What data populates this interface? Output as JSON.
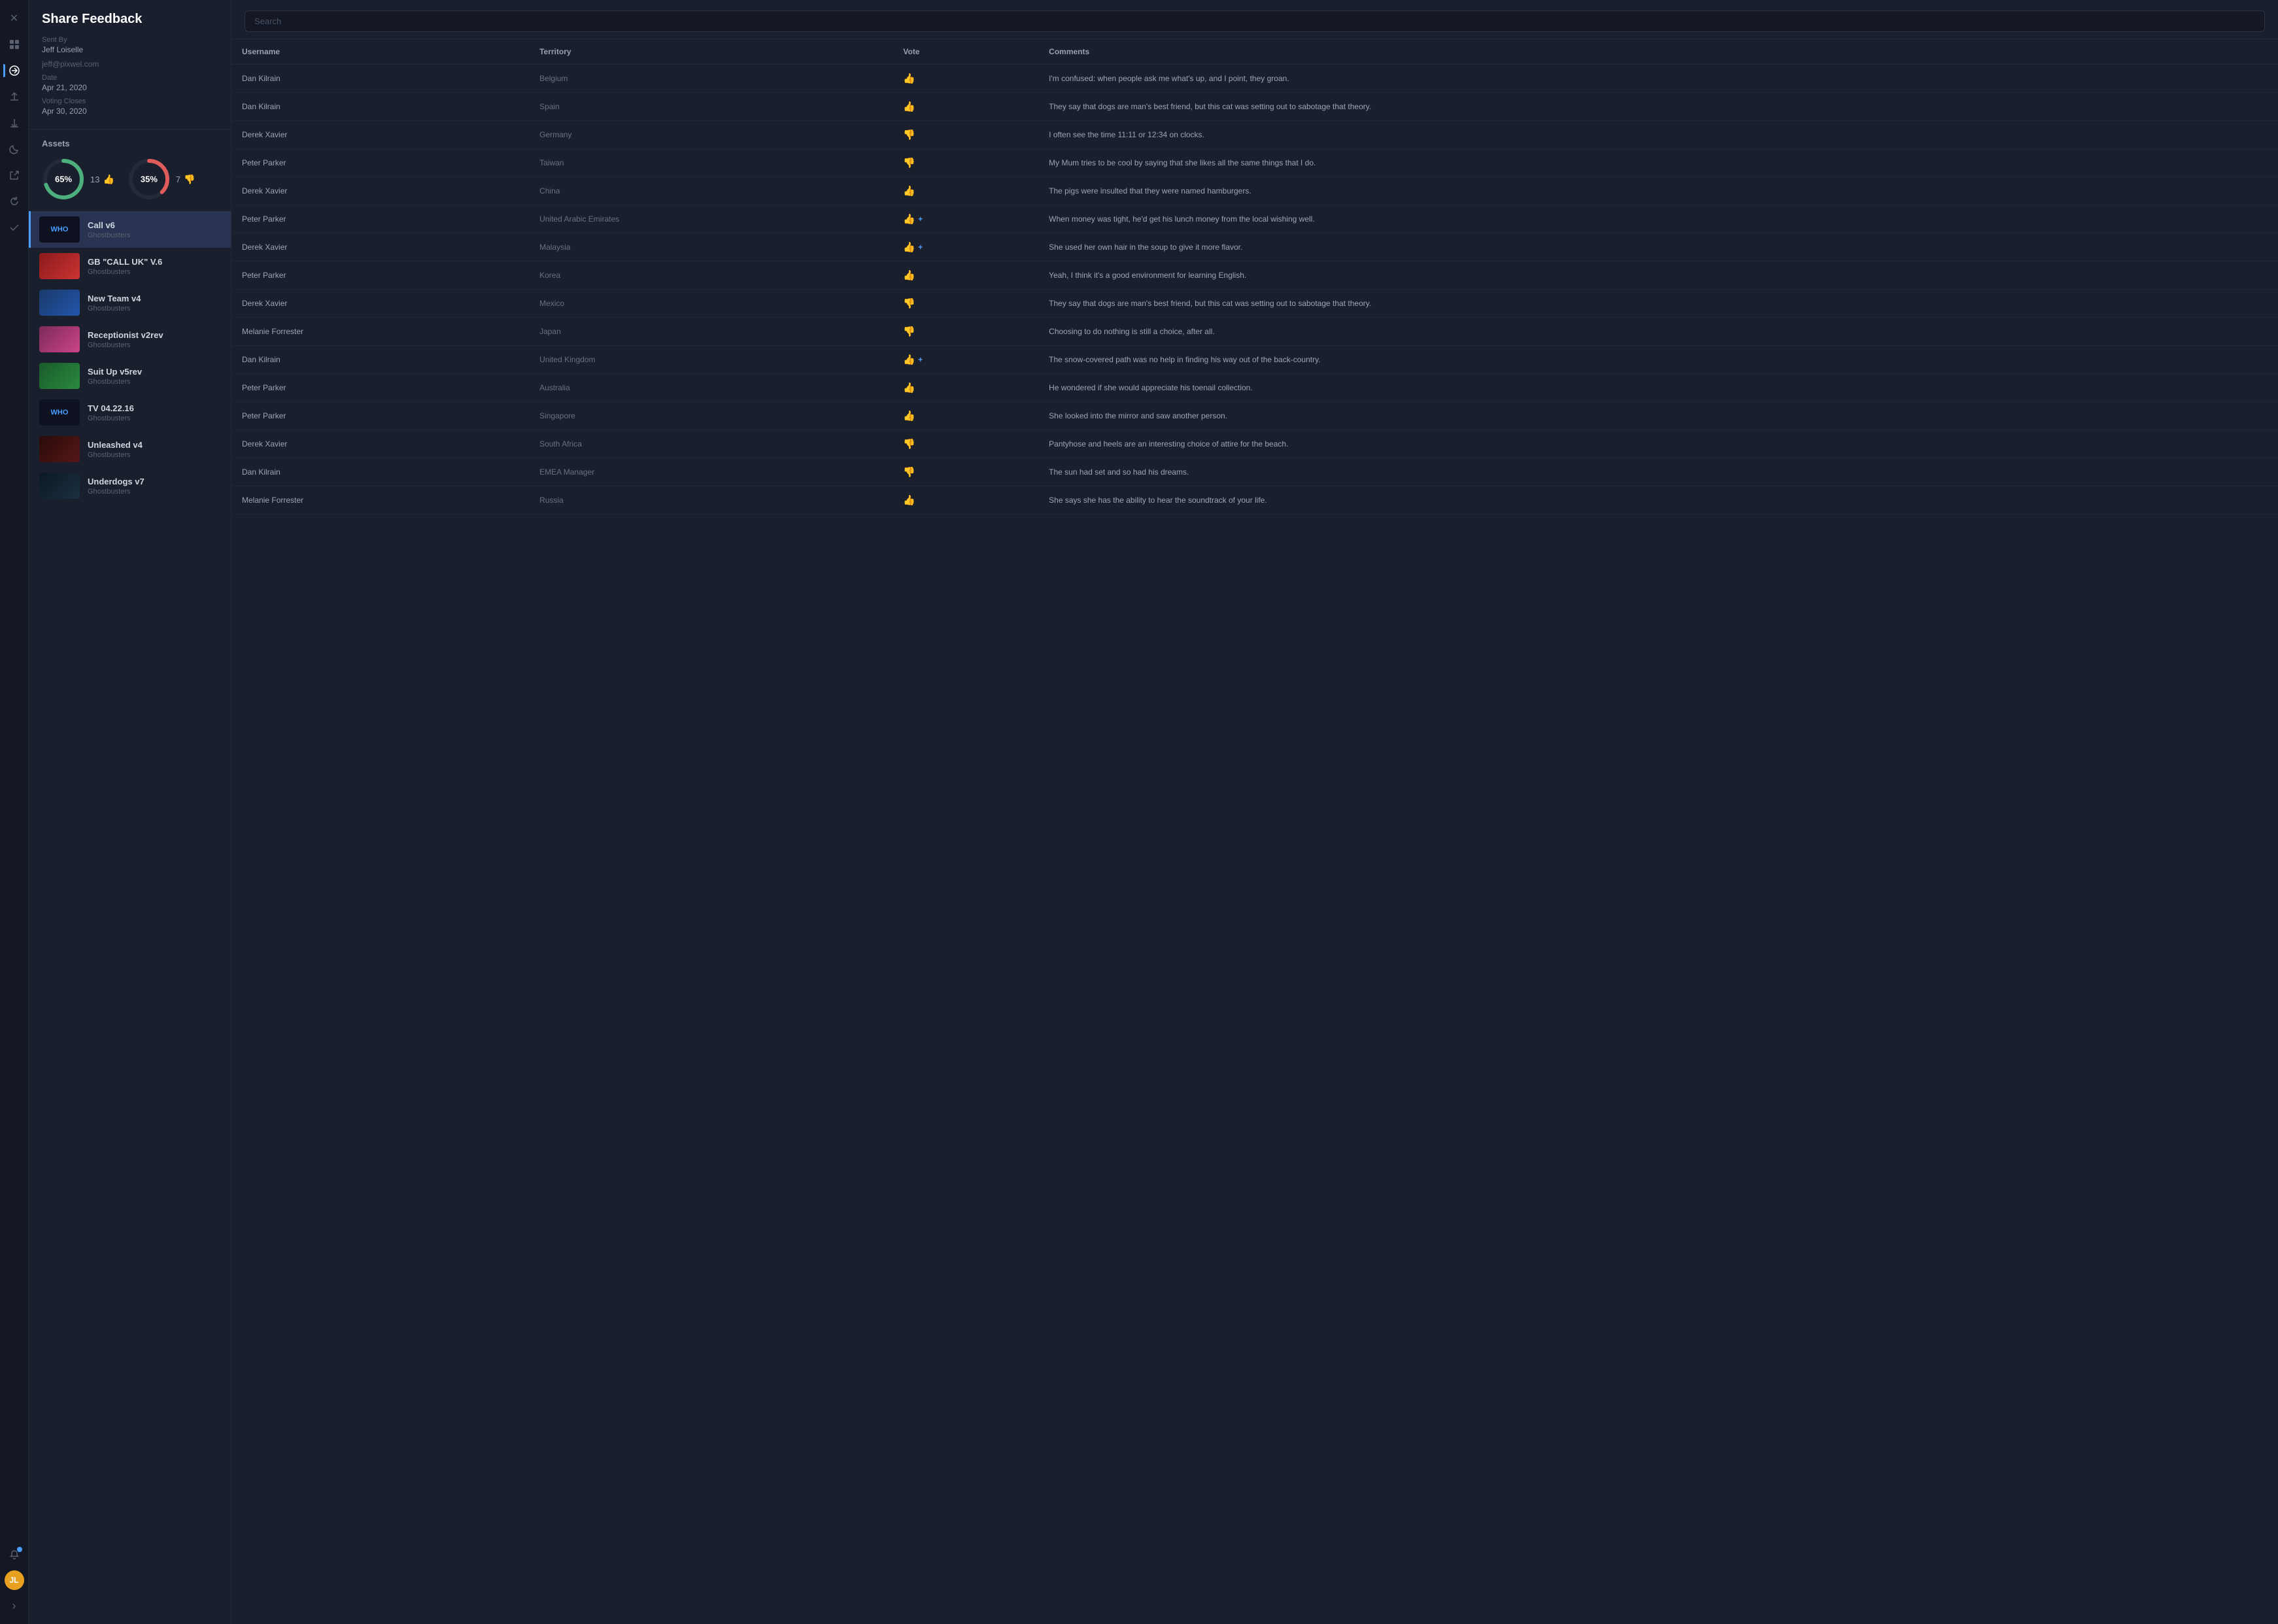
{
  "page": {
    "title": "Share Feedback"
  },
  "sidebar": {
    "sent_by_label": "Sent By",
    "sent_by_name": "Jeff Loiselle",
    "sent_by_email": "jeff@pixwel.com",
    "date_label": "Date",
    "date_value": "Apr 21, 2020",
    "voting_closes_label": "Voting Closes",
    "voting_closes_value": "Apr 30, 2020",
    "assets_label": "Assets"
  },
  "charts": {
    "upvote_percent": "65%",
    "upvote_count": "13",
    "downvote_percent": "35%",
    "downvote_count": "7",
    "upvote_circle_dash": "123",
    "upvote_circle_gap": "66",
    "downvote_circle_dash": "66",
    "downvote_circle_gap": "123"
  },
  "assets": [
    {
      "id": "a1",
      "name": "Call v6",
      "sub": "Ghostbusters",
      "thumb_class": "thumb-who",
      "thumb_text": "WHO",
      "selected": true
    },
    {
      "id": "a2",
      "name": "GB \"CALL UK\" V.6",
      "sub": "Ghostbusters",
      "thumb_class": "thumb-red",
      "thumb_text": "",
      "selected": false
    },
    {
      "id": "a3",
      "name": "New Team v4",
      "sub": "Ghostbusters",
      "thumb_class": "thumb-blue",
      "thumb_text": "",
      "selected": false
    },
    {
      "id": "a4",
      "name": "Receptionist v2rev",
      "sub": "Ghostbusters",
      "thumb_class": "thumb-pink",
      "thumb_text": "",
      "selected": false
    },
    {
      "id": "a5",
      "name": "Suit Up v5rev",
      "sub": "Ghostbusters",
      "thumb_class": "thumb-green",
      "thumb_text": "",
      "selected": false
    },
    {
      "id": "a6",
      "name": "TV 04.22.16",
      "sub": "Ghostbusters",
      "thumb_class": "thumb-who",
      "thumb_text": "WHO",
      "selected": false
    },
    {
      "id": "a7",
      "name": "Unleashed v4",
      "sub": "Ghostbusters",
      "thumb_class": "thumb-darkred",
      "thumb_text": "",
      "selected": false
    },
    {
      "id": "a8",
      "name": "Underdogs v7",
      "sub": "Ghostbusters",
      "thumb_class": "thumb-dark",
      "thumb_text": "",
      "selected": false
    }
  ],
  "search": {
    "placeholder": "Search"
  },
  "table": {
    "headers": [
      "Username",
      "Territory",
      "Vote",
      "Comments"
    ],
    "rows": [
      {
        "username": "Dan Kilrain",
        "territory": "Belgium",
        "vote": "up",
        "comment": "I'm confused: when people ask me what's up, and I point, they groan."
      },
      {
        "username": "Dan Kilrain",
        "territory": "Spain",
        "vote": "up",
        "comment": "They say that dogs are man's best friend, but this cat was setting out to sabotage that theory."
      },
      {
        "username": "Derek Xavier",
        "territory": "Germany",
        "vote": "down",
        "comment": "I often see the time 11:11 or 12:34 on clocks."
      },
      {
        "username": "Peter Parker",
        "territory": "Taiwan",
        "vote": "down",
        "comment": "My Mum tries to be cool by saying that she likes all the same things that I do."
      },
      {
        "username": "Derek Xavier",
        "territory": "China",
        "vote": "up",
        "comment": "The pigs were insulted that they were named hamburgers."
      },
      {
        "username": "Peter Parker",
        "territory": "United Arabic Emirates",
        "vote": "up_plus",
        "comment": "When money was tight, he'd get his lunch money from the local wishing well."
      },
      {
        "username": "Derek Xavier",
        "territory": "Malaysia",
        "vote": "up_plus",
        "comment": "She used her own hair in the soup to give it more flavor."
      },
      {
        "username": "Peter Parker",
        "territory": "Korea",
        "vote": "up",
        "comment": "Yeah, I think it's a good environment for learning English."
      },
      {
        "username": "Derek Xavier",
        "territory": "Mexico",
        "vote": "down",
        "comment": "They say that dogs are man's best friend, but this cat was setting out to sabotage that theory."
      },
      {
        "username": "Melanie Forrester",
        "territory": "Japan",
        "vote": "down",
        "comment": "Choosing to do nothing is still a choice, after all."
      },
      {
        "username": "Dan Kilrain",
        "territory": "United Kingdom",
        "vote": "up_plus",
        "comment": "The snow-covered path was no help in finding his way out of the back-country."
      },
      {
        "username": "Peter Parker",
        "territory": "Australia",
        "vote": "up",
        "comment": "He wondered if she would appreciate his toenail collection."
      },
      {
        "username": "Peter Parker",
        "territory": "Singapore",
        "vote": "up",
        "comment": "She looked into the mirror and saw another person."
      },
      {
        "username": "Derek Xavier",
        "territory": "South Africa",
        "vote": "down",
        "comment": "Pantyhose and heels are an interesting choice of attire for the beach."
      },
      {
        "username": "Dan Kilrain",
        "territory": "EMEA Manager",
        "vote": "down",
        "comment": "The sun had set and so had his dreams."
      },
      {
        "username": "Melanie Forrester",
        "territory": "Russia",
        "vote": "up",
        "comment": "She says she has the ability to hear the soundtrack of your life."
      }
    ]
  },
  "nav_icons": {
    "close": "✕",
    "grid": "⊞",
    "share": "⬡",
    "upload": "↑",
    "upload2": "↓",
    "moon": "☾",
    "export": "↗",
    "refresh": "↺",
    "check": "✓",
    "bell": "🔔",
    "chevron": "›"
  },
  "user_initials": "JL"
}
